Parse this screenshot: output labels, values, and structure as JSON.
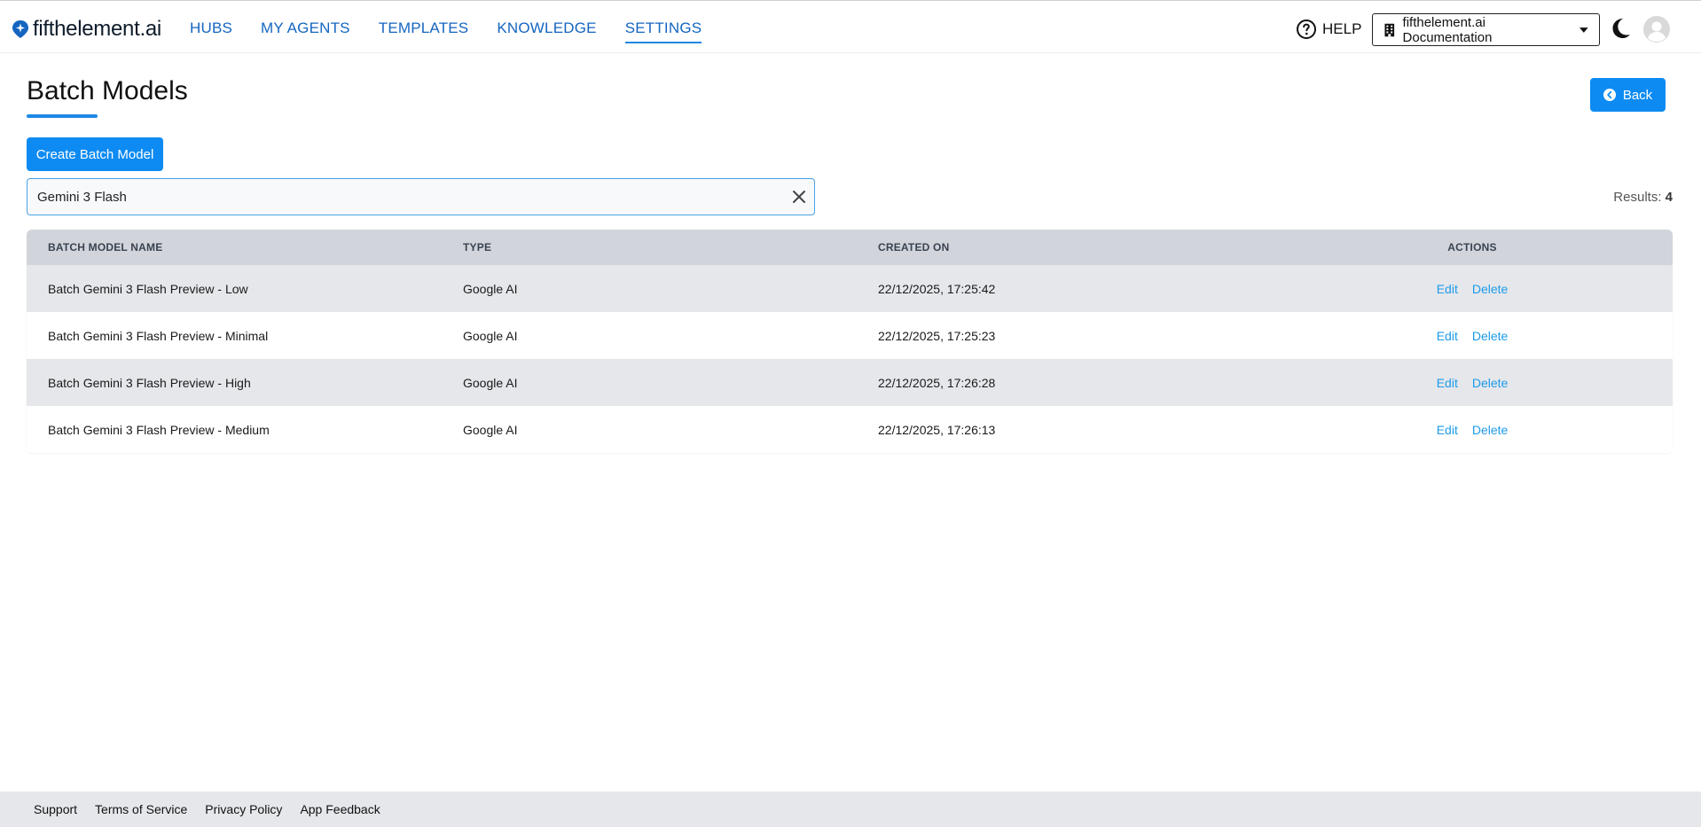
{
  "brand": {
    "name": "fifthelement.ai",
    "accent": "#1e88e5"
  },
  "nav": {
    "items": [
      {
        "label": "HUBS"
      },
      {
        "label": "MY AGENTS"
      },
      {
        "label": "TEMPLATES"
      },
      {
        "label": "KNOWLEDGE"
      },
      {
        "label": "SETTINGS",
        "active": true
      }
    ]
  },
  "header": {
    "help_label": "HELP",
    "workspace_label": "fifthelement.ai Documentation",
    "icons": [
      "help-circle-icon",
      "building-icon",
      "caret-down-icon",
      "moon-icon",
      "avatar-icon"
    ]
  },
  "page": {
    "title": "Batch Models",
    "back_label": "Back",
    "create_label": "Create Batch Model",
    "search_value": "Gemini 3 Flash",
    "results_label": "Results:",
    "results_count": "4"
  },
  "table": {
    "headers": [
      "BATCH MODEL NAME",
      "TYPE",
      "CREATED ON",
      "ACTIONS"
    ],
    "rows": [
      {
        "name": "Batch Gemini 3 Flash Preview - Low",
        "type": "Google AI",
        "created": "22/12/2025, 17:25:42",
        "edit": "Edit",
        "delete": "Delete"
      },
      {
        "name": "Batch Gemini 3 Flash Preview - Minimal",
        "type": "Google AI",
        "created": "22/12/2025, 17:25:23",
        "edit": "Edit",
        "delete": "Delete"
      },
      {
        "name": "Batch Gemini 3 Flash Preview - High",
        "type": "Google AI",
        "created": "22/12/2025, 17:26:28",
        "edit": "Edit",
        "delete": "Delete"
      },
      {
        "name": "Batch Gemini 3 Flash Preview - Medium",
        "type": "Google AI",
        "created": "22/12/2025, 17:26:13",
        "edit": "Edit",
        "delete": "Delete"
      }
    ]
  },
  "footer": {
    "links": [
      "Support",
      "Terms of Service",
      "Privacy Policy",
      "App Feedback"
    ]
  }
}
